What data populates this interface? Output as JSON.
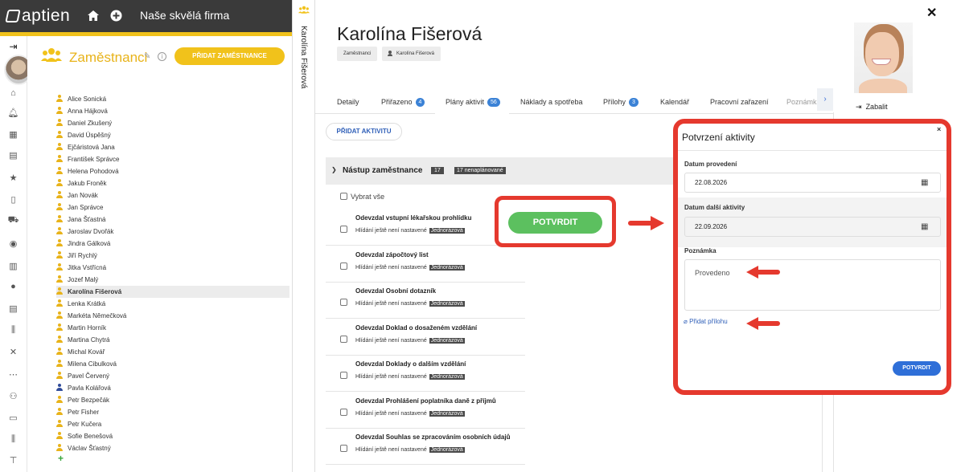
{
  "app": {
    "logo": "aptien",
    "company": "Naše skvělá firma"
  },
  "employees_panel": {
    "title": "Zaměstnanci",
    "add_button": "PŘIDAT ZAMĚSTNANCE",
    "employees": [
      {
        "name": "Alice Sonická",
        "color": "yellow"
      },
      {
        "name": "Anna Hájková",
        "color": "yellow"
      },
      {
        "name": "Daniel Zkušený",
        "color": "yellow"
      },
      {
        "name": "David Úspěšný",
        "color": "yellow"
      },
      {
        "name": "Ejčáristová Jana",
        "color": "yellow"
      },
      {
        "name": "František Správce",
        "color": "yellow"
      },
      {
        "name": "Helena Pohodová",
        "color": "yellow"
      },
      {
        "name": "Jakub Froněk",
        "color": "yellow"
      },
      {
        "name": "Jan Novák",
        "color": "yellow"
      },
      {
        "name": "Jan Správce",
        "color": "yellow"
      },
      {
        "name": "Jana Šťastná",
        "color": "yellow"
      },
      {
        "name": "Jaroslav Dvořák",
        "color": "yellow"
      },
      {
        "name": "Jindra Gálková",
        "color": "yellow"
      },
      {
        "name": "Jiří Rychlý",
        "color": "yellow"
      },
      {
        "name": "Jitka Vstřícná",
        "color": "yellow"
      },
      {
        "name": "Jozef Malý",
        "color": "yellow"
      },
      {
        "name": "Karolína Fišerová",
        "color": "yellow",
        "selected": true
      },
      {
        "name": "Lenka Krátká",
        "color": "yellow"
      },
      {
        "name": "Markéta Němečková",
        "color": "yellow"
      },
      {
        "name": "Martin Horník",
        "color": "yellow"
      },
      {
        "name": "Martina Chytrá",
        "color": "yellow"
      },
      {
        "name": "Michal Kovář",
        "color": "yellow"
      },
      {
        "name": "Milena Cibulková",
        "color": "yellow"
      },
      {
        "name": "Pavel Červený",
        "color": "yellow"
      },
      {
        "name": "Pavla Kolářová",
        "color": "blue"
      },
      {
        "name": "Petr Bezpečák",
        "color": "yellow"
      },
      {
        "name": "Petr Fisher",
        "color": "yellow"
      },
      {
        "name": "Petr Kučera",
        "color": "yellow"
      },
      {
        "name": "Sofie Benešová",
        "color": "yellow"
      },
      {
        "name": "Václav Šťastný",
        "color": "yellow"
      }
    ]
  },
  "vertical_label": "Karolína Fišerová",
  "detail": {
    "name": "Karolína Fišerová",
    "chip_employees": "Zaměstnanci",
    "chip_person": "Karolína Fišerová",
    "collapse": "Zabalit",
    "tabs": [
      {
        "label": "Detaily"
      },
      {
        "label": "Přiřazeno",
        "badge": "4"
      },
      {
        "label": "Plány aktivit",
        "badge": "56",
        "active": true
      },
      {
        "label": "Náklady a spotřeba"
      },
      {
        "label": "Přílohy",
        "badge": "3"
      },
      {
        "label": "Kalendář"
      },
      {
        "label": "Pracovní zařazení"
      },
      {
        "label": "Poznámk"
      }
    ],
    "add_activity": "PŘIDAT AKTIVITU",
    "section": {
      "title": "Nástup zaměstnance",
      "count": "17",
      "unplanned": "17 nenaplánované",
      "select_all": "Vybrat vše"
    },
    "tasks": [
      {
        "title": "Odevzdal vstupní lékařskou prohlídku",
        "status": "Hlídání ještě není nastavené",
        "tag": "Jednorázová"
      },
      {
        "title": "Odevzdal zápočtový list",
        "status": "Hlídání ještě není nastavené",
        "tag": "Jednorázová"
      },
      {
        "title": "Odevzdal Osobní dotazník",
        "status": "Hlídání ještě není nastavené",
        "tag": "Jednorázová"
      },
      {
        "title": "Odevzdal Doklad o dosaženém vzdělání",
        "status": "Hlídání ještě není nastavené",
        "tag": "Jednorázová"
      },
      {
        "title": "Odevzdal Doklady o dalším vzdělání",
        "status": "Hlídání ještě není nastavené",
        "tag": "Jednorázová"
      },
      {
        "title": "Odevzdal Prohlášení poplatníka daně z příjmů",
        "status": "Hlídání ještě není nastavené",
        "tag": "Jednorázová"
      },
      {
        "title": "Odevzdal Souhlas se zpracováním osobních údajů",
        "status": "Hlídání ještě není nastavené",
        "tag": "Jednorázová"
      }
    ],
    "confirm_big": "POTVRDIT"
  },
  "modal": {
    "title": "Potvrzení aktivity",
    "date_label": "Datum provedení",
    "date_value": "22.08.2026",
    "next_label": "Datum další aktivity",
    "next_value": "22.09.2026",
    "note_label": "Poznámka",
    "note_value": "Provedeno",
    "attach": "Přidat přílohu",
    "confirm": "POTVRDIT"
  },
  "colors": {
    "accent_yellow": "#f1c21b",
    "primary_blue": "#2f6fd8",
    "green": "#5cc05f",
    "highlight_red": "#e5392e"
  }
}
